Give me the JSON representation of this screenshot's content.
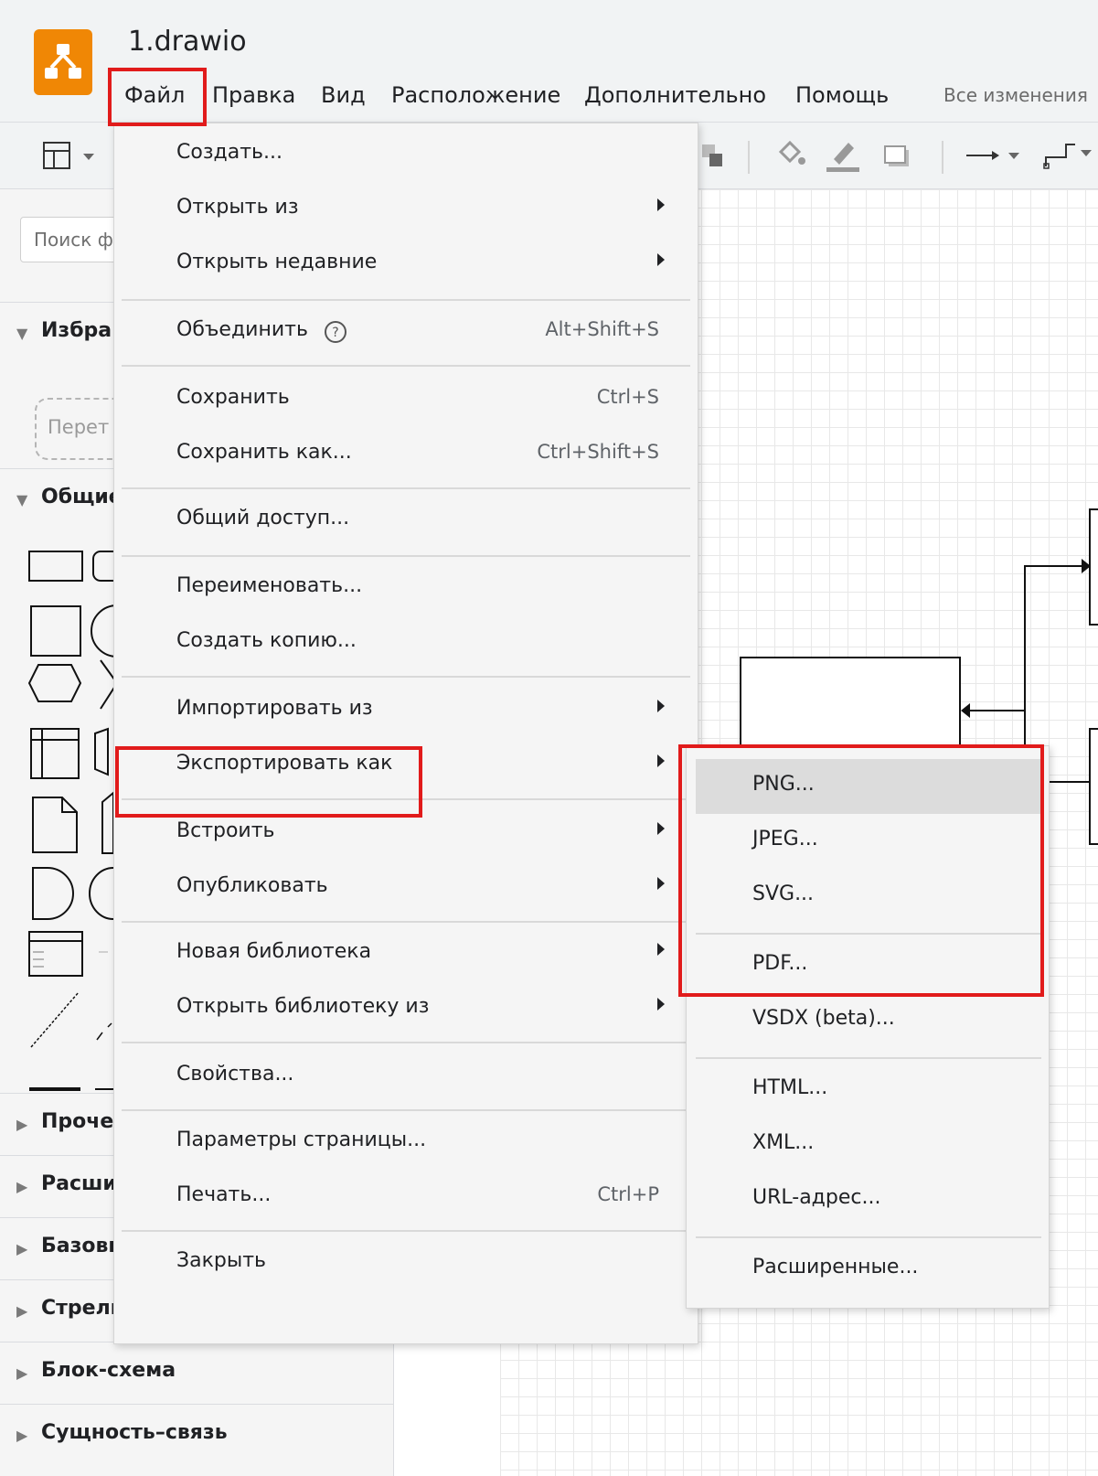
{
  "app": {
    "title": "1.drawio",
    "status": "Все изменения"
  },
  "menubar": [
    "Файл",
    "Правка",
    "Вид",
    "Расположение",
    "Дополнительно",
    "Помощь"
  ],
  "sidebar": {
    "search_placeholder": "Поиск ф",
    "dropzone_text": "Перет",
    "sections": [
      "Избра",
      "Общие",
      "Проче",
      "Расши",
      "Базовь",
      "Стрелки",
      "Блок-схема",
      "Сущность–связь"
    ]
  },
  "file_menu": {
    "items": [
      {
        "label": "Создать..."
      },
      {
        "label": "Открыть из",
        "submenu": true
      },
      {
        "label": "Открыть недавние",
        "submenu": true
      },
      {
        "label": "Объединить",
        "help": true,
        "shortcut": "Alt+Shift+S"
      },
      {
        "label": "Сохранить",
        "shortcut": "Ctrl+S"
      },
      {
        "label": "Сохранить как...",
        "shortcut": "Ctrl+Shift+S"
      },
      {
        "label": "Общий доступ..."
      },
      {
        "label": "Переименовать..."
      },
      {
        "label": "Создать копию..."
      },
      {
        "label": "Импортировать из",
        "submenu": true
      },
      {
        "label": "Экспортировать как",
        "submenu": true
      },
      {
        "label": "Встроить",
        "submenu": true
      },
      {
        "label": "Опубликовать",
        "submenu": true
      },
      {
        "label": "Новая библиотека",
        "submenu": true
      },
      {
        "label": "Открыть библиотеку из",
        "submenu": true
      },
      {
        "label": "Свойства..."
      },
      {
        "label": "Параметры страницы..."
      },
      {
        "label": "Печать...",
        "shortcut": "Ctrl+P"
      },
      {
        "label": "Закрыть"
      }
    ]
  },
  "export_menu": {
    "items": [
      "PNG...",
      "JPEG...",
      "SVG...",
      "PDF...",
      "VSDX (beta)...",
      "HTML...",
      "XML...",
      "URL-адрес...",
      "Расширенные..."
    ]
  },
  "colors": {
    "highlight": "#e11b1b",
    "logo": "#f08705"
  }
}
